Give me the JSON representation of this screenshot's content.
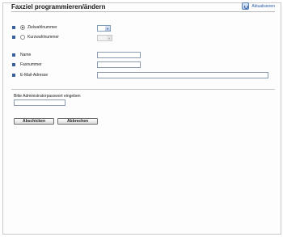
{
  "page": {
    "title": "Faxziel programmieren/ändern",
    "refresh_label": "Aktualisieren"
  },
  "dial_type": {
    "option_dial_number": "Zielwahlnummer",
    "option_speed_dial": "Kurzwahlnummer",
    "dial_number_value": "",
    "speed_dial_value": ""
  },
  "fields": {
    "name_label": "Name",
    "fax_label": "Faxnummer",
    "email_label": "E-Mail-Adresse",
    "name_value": "",
    "fax_value": "",
    "email_value": ""
  },
  "admin": {
    "prompt": "Bitte Administratorpasswort eingeben",
    "password_value": ""
  },
  "buttons": {
    "submit": "Abschicken",
    "cancel": "Abbrechen"
  }
}
